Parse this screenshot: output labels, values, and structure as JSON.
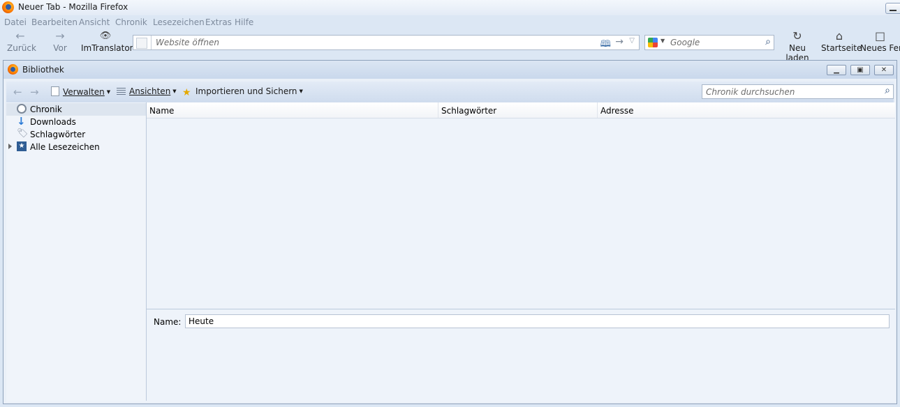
{
  "firefox": {
    "title": "Neuer Tab - Mozilla Firefox",
    "menu": [
      "Datei",
      "Bearbeiten",
      "Ansicht",
      "Chronik",
      "Lesezeichen",
      "Extras",
      "Hilfe"
    ],
    "nav": {
      "back": "Zurück",
      "forward": "Vor",
      "imtranslator": "ImTranslator",
      "reload": "Neu laden",
      "home": "Startseite",
      "new_window": "Neues Fenster"
    },
    "url_placeholder": "Website öffnen",
    "search_placeholder": "Google"
  },
  "library": {
    "title": "Bibliothek",
    "toolbar": {
      "organize": "Verwalten",
      "views": "Ansichten",
      "import_backup": "Importieren und Sichern",
      "search_placeholder": "Chronik durchsuchen"
    },
    "sidebar": [
      {
        "label": "Chronik",
        "icon": "clock-icon",
        "selected": true
      },
      {
        "label": "Downloads",
        "icon": "download-arrow-icon",
        "selected": false
      },
      {
        "label": "Schlagwörter",
        "icon": "tag-icon",
        "selected": false
      },
      {
        "label": "Alle Lesezeichen",
        "icon": "bookmark-star-icon",
        "selected": false,
        "expandable": true
      }
    ],
    "columns": [
      "Name",
      "Schlagwörter",
      "Adresse"
    ],
    "details": {
      "name_label": "Name:",
      "name_value": "Heute"
    }
  }
}
